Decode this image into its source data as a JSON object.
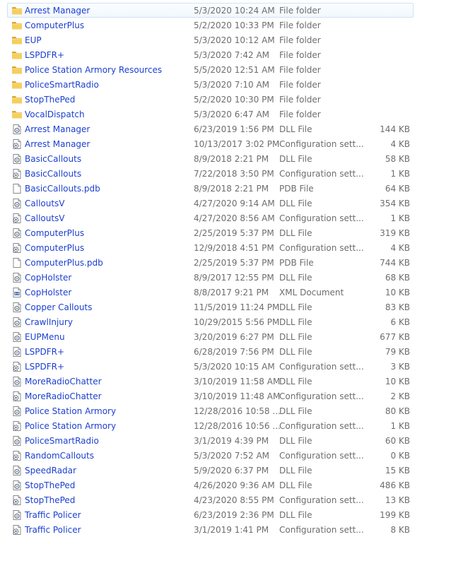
{
  "files": [
    {
      "name": "Arrest Manager",
      "date": "5/3/2020 10:24 AM",
      "type": "File folder",
      "size": "",
      "icon": "folder-icon",
      "selected": true
    },
    {
      "name": "ComputerPlus",
      "date": "5/2/2020 10:33 PM",
      "type": "File folder",
      "size": "",
      "icon": "folder-icon"
    },
    {
      "name": "EUP",
      "date": "5/3/2020 10:12 AM",
      "type": "File folder",
      "size": "",
      "icon": "folder-icon"
    },
    {
      "name": "LSPDFR+",
      "date": "5/3/2020 7:42 AM",
      "type": "File folder",
      "size": "",
      "icon": "folder-icon"
    },
    {
      "name": "Police Station Armory Resources",
      "date": "5/5/2020 12:51 AM",
      "type": "File folder",
      "size": "",
      "icon": "folder-icon"
    },
    {
      "name": "PoliceSmartRadio",
      "date": "5/3/2020 7:10 AM",
      "type": "File folder",
      "size": "",
      "icon": "folder-icon"
    },
    {
      "name": "StopThePed",
      "date": "5/2/2020 10:30 PM",
      "type": "File folder",
      "size": "",
      "icon": "folder-icon"
    },
    {
      "name": "VocalDispatch",
      "date": "5/3/2020 6:47 AM",
      "type": "File folder",
      "size": "",
      "icon": "folder-icon"
    },
    {
      "name": "Arrest Manager",
      "date": "6/23/2019 1:56 PM",
      "type": "DLL File",
      "size": "144 KB",
      "icon": "dll-file-icon"
    },
    {
      "name": "Arrest Manager",
      "date": "10/13/2017 3:02 PM",
      "type": "Configuration sett...",
      "size": "4 KB",
      "icon": "config-file-icon"
    },
    {
      "name": "BasicCallouts",
      "date": "8/9/2018 2:21 PM",
      "type": "DLL File",
      "size": "58 KB",
      "icon": "dll-file-icon"
    },
    {
      "name": "BasicCallouts",
      "date": "7/22/2018 3:50 PM",
      "type": "Configuration sett...",
      "size": "1 KB",
      "icon": "config-file-icon"
    },
    {
      "name": "BasicCallouts.pdb",
      "date": "8/9/2018 2:21 PM",
      "type": "PDB File",
      "size": "64 KB",
      "icon": "blank-file-icon"
    },
    {
      "name": "CalloutsV",
      "date": "4/27/2020 9:14 AM",
      "type": "DLL File",
      "size": "354 KB",
      "icon": "dll-file-icon"
    },
    {
      "name": "CalloutsV",
      "date": "4/27/2020 8:56 AM",
      "type": "Configuration sett...",
      "size": "1 KB",
      "icon": "config-file-icon"
    },
    {
      "name": "ComputerPlus",
      "date": "2/25/2019 5:37 PM",
      "type": "DLL File",
      "size": "319 KB",
      "icon": "dll-file-icon"
    },
    {
      "name": "ComputerPlus",
      "date": "12/9/2018 4:51 PM",
      "type": "Configuration sett...",
      "size": "4 KB",
      "icon": "config-file-icon"
    },
    {
      "name": "ComputerPlus.pdb",
      "date": "2/25/2019 5:37 PM",
      "type": "PDB File",
      "size": "744 KB",
      "icon": "blank-file-icon"
    },
    {
      "name": "CopHolster",
      "date": "8/9/2017 12:55 PM",
      "type": "DLL File",
      "size": "68 KB",
      "icon": "dll-file-icon"
    },
    {
      "name": "CopHolster",
      "date": "8/8/2017 9:21 PM",
      "type": "XML Document",
      "size": "10 KB",
      "icon": "xml-file-icon"
    },
    {
      "name": "Copper Callouts",
      "date": "11/5/2019 11:24 PM",
      "type": "DLL File",
      "size": "83 KB",
      "icon": "dll-file-icon"
    },
    {
      "name": "CrawlInjury",
      "date": "10/29/2015 5:56 PM",
      "type": "DLL File",
      "size": "6 KB",
      "icon": "dll-file-icon"
    },
    {
      "name": "EUPMenu",
      "date": "3/20/2019 6:27 PM",
      "type": "DLL File",
      "size": "677 KB",
      "icon": "dll-file-icon"
    },
    {
      "name": "LSPDFR+",
      "date": "6/28/2019 7:56 PM",
      "type": "DLL File",
      "size": "79 KB",
      "icon": "dll-file-icon"
    },
    {
      "name": "LSPDFR+",
      "date": "5/3/2020 10:15 AM",
      "type": "Configuration sett...",
      "size": "3 KB",
      "icon": "config-file-icon"
    },
    {
      "name": "MoreRadioChatter",
      "date": "3/10/2019 11:58 AM",
      "type": "DLL File",
      "size": "10 KB",
      "icon": "dll-file-icon"
    },
    {
      "name": "MoreRadioChatter",
      "date": "3/10/2019 11:48 AM",
      "type": "Configuration sett...",
      "size": "2 KB",
      "icon": "config-file-icon"
    },
    {
      "name": "Police Station Armory",
      "date": "12/28/2016 10:58 ...",
      "type": "DLL File",
      "size": "80 KB",
      "icon": "dll-file-icon"
    },
    {
      "name": "Police Station Armory",
      "date": "12/28/2016 10:56 ...",
      "type": "Configuration sett...",
      "size": "1 KB",
      "icon": "config-file-icon"
    },
    {
      "name": "PoliceSmartRadio",
      "date": "3/1/2019 4:39 PM",
      "type": "DLL File",
      "size": "60 KB",
      "icon": "dll-file-icon"
    },
    {
      "name": "RandomCallouts",
      "date": "5/3/2020 7:52 AM",
      "type": "Configuration sett...",
      "size": "0 KB",
      "icon": "config-file-icon"
    },
    {
      "name": "SpeedRadar",
      "date": "5/9/2020 6:37 PM",
      "type": "DLL File",
      "size": "15 KB",
      "icon": "dll-file-icon"
    },
    {
      "name": "StopThePed",
      "date": "4/26/2020 9:36 AM",
      "type": "DLL File",
      "size": "486 KB",
      "icon": "dll-file-icon"
    },
    {
      "name": "StopThePed",
      "date": "4/23/2020 8:55 PM",
      "type": "Configuration sett...",
      "size": "13 KB",
      "icon": "config-file-icon"
    },
    {
      "name": "Traffic Policer",
      "date": "6/23/2019 2:36 PM",
      "type": "DLL File",
      "size": "199 KB",
      "icon": "dll-file-icon"
    },
    {
      "name": "Traffic Policer",
      "date": "3/1/2019 1:41 PM",
      "type": "Configuration sett...",
      "size": "8 KB",
      "icon": "config-file-icon"
    }
  ]
}
